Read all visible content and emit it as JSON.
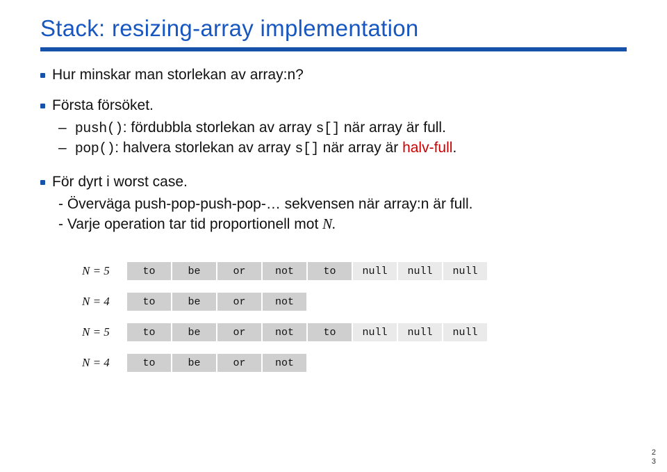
{
  "title": "Stack:  resizing-array implementation",
  "bullets": {
    "b1": "Hur minskar man storlekan av array:n?",
    "b2": "Första försöket.",
    "s1_pre": "push()",
    "s1_post": ": fördubbla storlekan av array ",
    "s1_code": "s[]",
    "s1_tail": " när array är full.",
    "s2_pre": "pop()",
    "s2_post": ": halvera storlekan av array ",
    "s2_code": "s[]",
    "s2_tail": " när array är ",
    "s2_red": "halv-full",
    "s2_dot": ".",
    "b3": "För dyrt i worst case.",
    "s3": "- Överväga push-pop-push-pop-… sekvensen när array:n är full.",
    "s4_a": "- Varje operation tar tid proportionell mot ",
    "s4_n": "N.",
    "dash": "–"
  },
  "arrays": [
    {
      "label": "N = 5",
      "cells": [
        {
          "v": "to",
          "f": true
        },
        {
          "v": "be",
          "f": true
        },
        {
          "v": "or",
          "f": true
        },
        {
          "v": "not",
          "f": true
        },
        {
          "v": "to",
          "f": true
        },
        {
          "v": "null",
          "f": false
        },
        {
          "v": "null",
          "f": false
        },
        {
          "v": "null",
          "f": false
        }
      ]
    },
    {
      "label": "N = 4",
      "cells": [
        {
          "v": "to",
          "f": true
        },
        {
          "v": "be",
          "f": true
        },
        {
          "v": "or",
          "f": true
        },
        {
          "v": "not",
          "f": true
        }
      ]
    },
    {
      "label": "N = 5",
      "cells": [
        {
          "v": "to",
          "f": true
        },
        {
          "v": "be",
          "f": true
        },
        {
          "v": "or",
          "f": true
        },
        {
          "v": "not",
          "f": true
        },
        {
          "v": "to",
          "f": true
        },
        {
          "v": "null",
          "f": false
        },
        {
          "v": "null",
          "f": false
        },
        {
          "v": "null",
          "f": false
        }
      ]
    },
    {
      "label": "N = 4",
      "cells": [
        {
          "v": "to",
          "f": true
        },
        {
          "v": "be",
          "f": true
        },
        {
          "v": "or",
          "f": true
        },
        {
          "v": "not",
          "f": true
        }
      ]
    }
  ],
  "pagenum_top": "2",
  "pagenum_bottom": "3"
}
